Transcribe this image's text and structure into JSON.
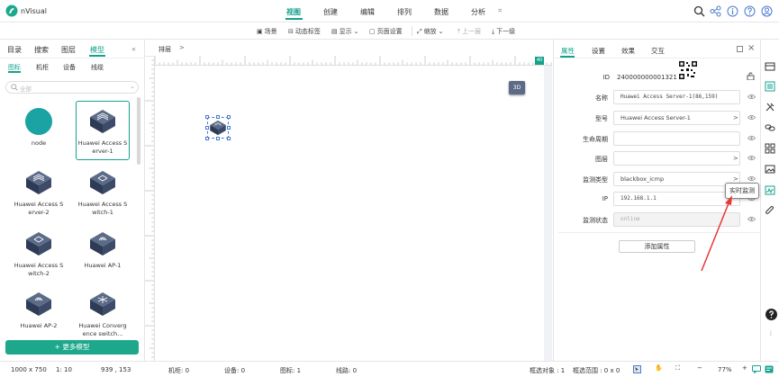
{
  "app": {
    "name": "nVisual"
  },
  "top_menu": [
    "视图",
    "创建",
    "编辑",
    "排列",
    "数据",
    "分析"
  ],
  "top_more": "¤",
  "toolbar": [
    {
      "label": "场景",
      "icon": "scene-icon"
    },
    {
      "label": "动态标签",
      "icon": "tag-icon"
    },
    {
      "label": "显示",
      "icon": "display-icon"
    },
    {
      "label": "页面设置",
      "icon": "page-icon"
    },
    {
      "label": "缩放",
      "icon": "zoom-icon"
    },
    {
      "label": "上一层",
      "icon": "up-layer-icon",
      "disabled": true
    },
    {
      "label": "下一级",
      "icon": "down-level-icon"
    }
  ],
  "left_panel": {
    "tabs": [
      "目录",
      "搜索",
      "图层",
      "模型"
    ],
    "collapse": "«",
    "subtabs": [
      "图标",
      "机柜",
      "设备",
      "线缆"
    ],
    "search_placeholder": "全部",
    "models": [
      {
        "label": "node",
        "icon": "node-icon"
      },
      {
        "label": "Huawei Access S erver-1",
        "icon": "access-server-icon",
        "selected": true
      },
      {
        "label": "Huawei Access S erver-2",
        "icon": "access-server-icon"
      },
      {
        "label": "Huawei Access S witch-1",
        "icon": "access-switch-icon"
      },
      {
        "label": "Huawei Access S witch-2",
        "icon": "access-switch-icon"
      },
      {
        "label": "Huawei AP-1",
        "icon": "wireless-ap-icon"
      },
      {
        "label": "Huawei AP-2",
        "icon": "wireless-ap-icon"
      },
      {
        "label": "Huawei Converg ence switch...",
        "icon": "convergence-switch-icon"
      }
    ],
    "more_button": "+ 更多模型"
  },
  "canvas": {
    "breadcrumb": "排层",
    "breadcrumb_arrow": ">",
    "btn_3d": "3D",
    "zoom_badge": "40"
  },
  "right_panel": {
    "tabs": [
      "属性",
      "设置",
      "效果",
      "交互"
    ],
    "id_label": "ID",
    "id_value": "240000000001321",
    "properties": [
      {
        "label": "名称",
        "value": "Huawei Access Server-1(86,159)",
        "mono": true,
        "resizable": true
      },
      {
        "label": "型号",
        "value": "Huawei Access Server-1",
        "arrow": ">"
      },
      {
        "label": "生命周期",
        "value": "",
        "resizable": true
      },
      {
        "label": "图层",
        "value": "",
        "arrow": ">"
      },
      {
        "label": "监测类型",
        "value": "blackbox_icmp",
        "arrow": ">"
      },
      {
        "label": "IP",
        "value": "192.168.1.1",
        "mono": true,
        "resizable": true
      },
      {
        "label": "监测状态",
        "value": "online",
        "mono": true,
        "disabled": true
      }
    ],
    "add_button": "添加属性"
  },
  "tooltip": "实时监测",
  "status_bar": {
    "size": "1000 x 750",
    "scale": "1: 10",
    "coords": "939 , 153",
    "cabinets": "机柜: 0",
    "devices": "设备: 0",
    "icons": "图标: 1",
    "lines": "线路: 0",
    "selected": "框选对象 : 1",
    "range": "框选范围 : 0 x 0",
    "zoom": "77%"
  },
  "colors": {
    "accent": "#15a28d",
    "button": "#1da88c",
    "arrow": "#e53935"
  }
}
